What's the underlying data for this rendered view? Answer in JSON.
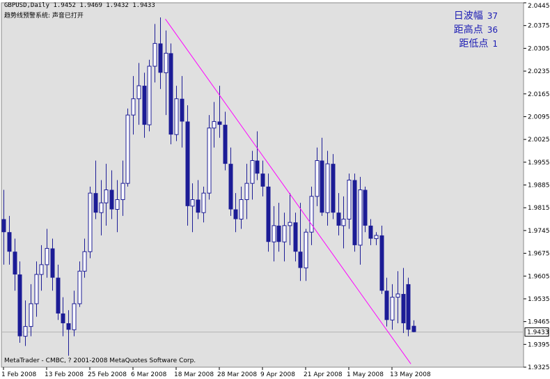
{
  "header": {
    "symbol_line": "GBPUSD,Daily  1.9452 1.9469 1.9432 1.9433",
    "tip_line": "趋势线预警系统: 声音已打开"
  },
  "stats": [
    {
      "label": "日波幅",
      "value": "37"
    },
    {
      "label": "距高点",
      "value": "36"
    },
    {
      "label": "距低点",
      "value": "1"
    }
  ],
  "watermark": "MetaTrader - CMBC, ? 2001-2008 MetaQuotes Software Corp.",
  "colors": {
    "background": "#e0e0e0",
    "frame": "#8a8a8a",
    "candle": "#1c1c96",
    "trendline": "#ff00ff",
    "current_price_line": "#b5b5b5"
  },
  "chart_data": {
    "type": "candlestick",
    "symbol": "GBPUSD",
    "timeframe": "Daily",
    "last_bar": {
      "open": 1.9452,
      "high": 1.9469,
      "low": 1.9432,
      "close": 1.9433
    },
    "current_price": 1.9433,
    "ylim": [
      1.9325,
      2.0445
    ],
    "y_ticks": [
      "2.0445",
      "2.0375",
      "2.0305",
      "2.0235",
      "2.0165",
      "2.0095",
      "2.0025",
      "1.9955",
      "1.9885",
      "1.9815",
      "1.9745",
      "1.9675",
      "1.9605",
      "1.9535",
      "1.9465",
      "1.9395",
      "1.9325"
    ],
    "x_ticks": [
      {
        "label": "1 Feb 2008",
        "index": 0
      },
      {
        "label": "13 Feb 2008",
        "index": 8
      },
      {
        "label": "25 Feb 2008",
        "index": 16
      },
      {
        "label": "6 Mar 2008",
        "index": 24
      },
      {
        "label": "18 Mar 2008",
        "index": 32
      },
      {
        "label": "28 Mar 2008",
        "index": 40
      },
      {
        "label": "9 Apr 2008",
        "index": 48
      },
      {
        "label": "21 Apr 2008",
        "index": 56
      },
      {
        "label": "1 May 2008",
        "index": 64
      },
      {
        "label": "13 May 2008",
        "index": 72
      }
    ],
    "trendline": {
      "from": {
        "index": 30,
        "price": 2.0395
      },
      "to": {
        "index": 75.5,
        "price": 1.9335
      }
    },
    "candles": [
      {
        "o": 1.978,
        "h": 1.987,
        "l": 1.964,
        "c": 1.974
      },
      {
        "o": 1.974,
        "h": 1.979,
        "l": 1.964,
        "c": 1.968
      },
      {
        "o": 1.968,
        "h": 1.972,
        "l": 1.956,
        "c": 1.961
      },
      {
        "o": 1.961,
        "h": 1.965,
        "l": 1.94,
        "c": 1.942
      },
      {
        "o": 1.942,
        "h": 1.953,
        "l": 1.939,
        "c": 1.945
      },
      {
        "o": 1.945,
        "h": 1.958,
        "l": 1.942,
        "c": 1.952
      },
      {
        "o": 1.952,
        "h": 1.965,
        "l": 1.948,
        "c": 1.961
      },
      {
        "o": 1.961,
        "h": 1.97,
        "l": 1.956,
        "c": 1.964
      },
      {
        "o": 1.964,
        "h": 1.975,
        "l": 1.96,
        "c": 1.969
      },
      {
        "o": 1.969,
        "h": 1.972,
        "l": 1.956,
        "c": 1.96
      },
      {
        "o": 1.96,
        "h": 1.964,
        "l": 1.947,
        "c": 1.949
      },
      {
        "o": 1.949,
        "h": 1.954,
        "l": 1.942,
        "c": 1.946
      },
      {
        "o": 1.946,
        "h": 1.95,
        "l": 1.936,
        "c": 1.944
      },
      {
        "o": 1.944,
        "h": 1.956,
        "l": 1.942,
        "c": 1.952
      },
      {
        "o": 1.952,
        "h": 1.965,
        "l": 1.951,
        "c": 1.962
      },
      {
        "o": 1.962,
        "h": 1.972,
        "l": 1.96,
        "c": 1.968
      },
      {
        "o": 1.968,
        "h": 1.988,
        "l": 1.966,
        "c": 1.986
      },
      {
        "o": 1.986,
        "h": 1.996,
        "l": 1.978,
        "c": 1.98
      },
      {
        "o": 1.98,
        "h": 1.99,
        "l": 1.973,
        "c": 1.983
      },
      {
        "o": 1.983,
        "h": 1.995,
        "l": 1.976,
        "c": 1.987
      },
      {
        "o": 1.987,
        "h": 1.993,
        "l": 1.978,
        "c": 1.981
      },
      {
        "o": 1.981,
        "h": 1.99,
        "l": 1.974,
        "c": 1.984
      },
      {
        "o": 1.984,
        "h": 1.996,
        "l": 1.979,
        "c": 1.989
      },
      {
        "o": 1.989,
        "h": 2.012,
        "l": 1.988,
        "c": 2.01
      },
      {
        "o": 2.01,
        "h": 2.022,
        "l": 2.004,
        "c": 2.015
      },
      {
        "o": 2.015,
        "h": 2.026,
        "l": 2.007,
        "c": 2.019
      },
      {
        "o": 2.019,
        "h": 2.023,
        "l": 2.003,
        "c": 2.007
      },
      {
        "o": 2.007,
        "h": 2.027,
        "l": 2.005,
        "c": 2.025
      },
      {
        "o": 2.025,
        "h": 2.038,
        "l": 2.02,
        "c": 2.032
      },
      {
        "o": 2.032,
        "h": 2.04,
        "l": 2.018,
        "c": 2.023
      },
      {
        "o": 2.023,
        "h": 2.036,
        "l": 2.01,
        "c": 2.029
      },
      {
        "o": 2.029,
        "h": 2.032,
        "l": 2.001,
        "c": 2.004
      },
      {
        "o": 2.004,
        "h": 2.019,
        "l": 2.002,
        "c": 2.015
      },
      {
        "o": 2.015,
        "h": 2.022,
        "l": 2.0,
        "c": 2.008
      },
      {
        "o": 2.008,
        "h": 2.013,
        "l": 1.976,
        "c": 1.982
      },
      {
        "o": 1.982,
        "h": 1.989,
        "l": 1.974,
        "c": 1.984
      },
      {
        "o": 1.984,
        "h": 1.99,
        "l": 1.978,
        "c": 1.98
      },
      {
        "o": 1.98,
        "h": 1.988,
        "l": 1.977,
        "c": 1.986
      },
      {
        "o": 1.986,
        "h": 2.01,
        "l": 1.984,
        "c": 2.006
      },
      {
        "o": 2.006,
        "h": 2.014,
        "l": 2.0,
        "c": 2.008
      },
      {
        "o": 2.008,
        "h": 2.019,
        "l": 2.003,
        "c": 2.007
      },
      {
        "o": 2.007,
        "h": 2.011,
        "l": 1.993,
        "c": 1.995
      },
      {
        "o": 1.995,
        "h": 2.0,
        "l": 1.979,
        "c": 1.981
      },
      {
        "o": 1.981,
        "h": 1.986,
        "l": 1.974,
        "c": 1.978
      },
      {
        "o": 1.978,
        "h": 1.988,
        "l": 1.975,
        "c": 1.984
      },
      {
        "o": 1.984,
        "h": 1.995,
        "l": 1.978,
        "c": 1.989
      },
      {
        "o": 1.989,
        "h": 1.999,
        "l": 1.984,
        "c": 1.996
      },
      {
        "o": 1.996,
        "h": 2.005,
        "l": 1.99,
        "c": 1.992
      },
      {
        "o": 1.992,
        "h": 1.996,
        "l": 1.985,
        "c": 1.988
      },
      {
        "o": 1.988,
        "h": 1.992,
        "l": 1.968,
        "c": 1.971
      },
      {
        "o": 1.971,
        "h": 1.982,
        "l": 1.965,
        "c": 1.976
      },
      {
        "o": 1.976,
        "h": 1.983,
        "l": 1.968,
        "c": 1.971
      },
      {
        "o": 1.971,
        "h": 1.98,
        "l": 1.965,
        "c": 1.976
      },
      {
        "o": 1.976,
        "h": 1.986,
        "l": 1.97,
        "c": 1.977
      },
      {
        "o": 1.977,
        "h": 1.98,
        "l": 1.965,
        "c": 1.968
      },
      {
        "o": 1.968,
        "h": 1.983,
        "l": 1.959,
        "c": 1.963
      },
      {
        "o": 1.963,
        "h": 1.975,
        "l": 1.959,
        "c": 1.974
      },
      {
        "o": 1.974,
        "h": 1.988,
        "l": 1.97,
        "c": 1.985
      },
      {
        "o": 1.985,
        "h": 2.0,
        "l": 1.982,
        "c": 1.996
      },
      {
        "o": 1.996,
        "h": 2.003,
        "l": 1.979,
        "c": 1.98
      },
      {
        "o": 1.98,
        "h": 1.999,
        "l": 1.976,
        "c": 1.995
      },
      {
        "o": 1.995,
        "h": 1.998,
        "l": 1.978,
        "c": 1.98
      },
      {
        "o": 1.98,
        "h": 1.986,
        "l": 1.973,
        "c": 1.976
      },
      {
        "o": 1.976,
        "h": 1.985,
        "l": 1.969,
        "c": 1.978
      },
      {
        "o": 1.978,
        "h": 1.992,
        "l": 1.975,
        "c": 1.99
      },
      {
        "o": 1.99,
        "h": 1.992,
        "l": 1.968,
        "c": 1.97
      },
      {
        "o": 1.97,
        "h": 1.991,
        "l": 1.964,
        "c": 1.987
      },
      {
        "o": 1.987,
        "h": 1.988,
        "l": 1.974,
        "c": 1.976
      },
      {
        "o": 1.976,
        "h": 1.978,
        "l": 1.97,
        "c": 1.972
      },
      {
        "o": 1.972,
        "h": 1.974,
        "l": 1.97,
        "c": 1.973
      },
      {
        "o": 1.973,
        "h": 1.976,
        "l": 1.955,
        "c": 1.956
      },
      {
        "o": 1.956,
        "h": 1.96,
        "l": 1.945,
        "c": 1.947
      },
      {
        "o": 1.947,
        "h": 1.958,
        "l": 1.944,
        "c": 1.954
      },
      {
        "o": 1.954,
        "h": 1.962,
        "l": 1.946,
        "c": 1.955
      },
      {
        "o": 1.955,
        "h": 1.963,
        "l": 1.943,
        "c": 1.946
      },
      {
        "o": 1.958,
        "h": 1.96,
        "l": 1.942,
        "c": 1.944
      },
      {
        "o": 1.9452,
        "h": 1.9469,
        "l": 1.9432,
        "c": 1.9433
      }
    ]
  }
}
